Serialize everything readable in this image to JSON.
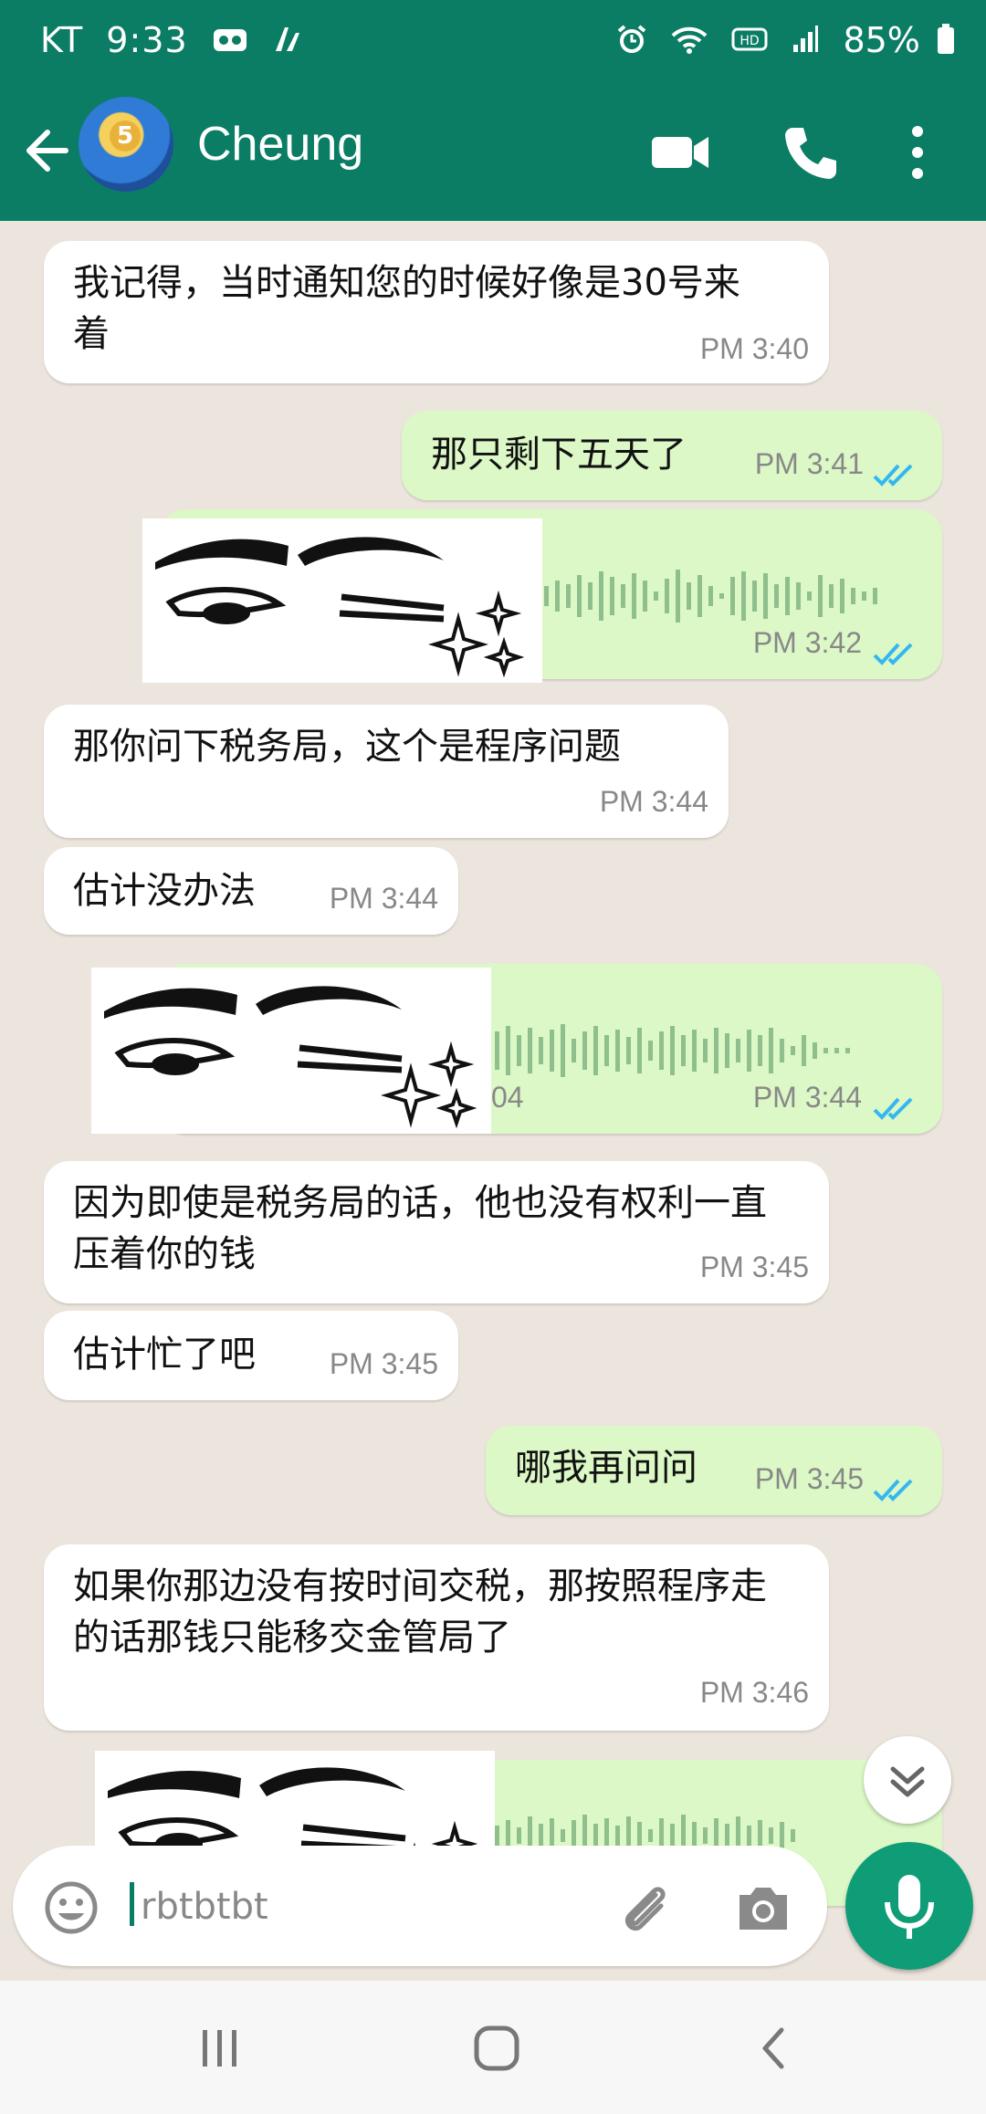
{
  "status_bar": {
    "carrier": "KT",
    "time": "9:33",
    "battery": "85%",
    "icons": [
      "voicemail-icon",
      "notification-icon",
      "alarm-icon",
      "wifi-icon",
      "hd-icon",
      "signal-icon",
      "battery-icon"
    ]
  },
  "header": {
    "contact_name": "Cheung",
    "avatar_badge": "5"
  },
  "messages": [
    {
      "dir": "in",
      "text": "我记得，当时通知您的时候好像是30号来着",
      "time": "PM 3:40"
    },
    {
      "dir": "out",
      "text": "那只剩下五天了",
      "time": "PM 3:41",
      "read": true
    },
    {
      "dir": "out",
      "type": "voice",
      "time": "PM 3:42",
      "read": true
    },
    {
      "dir": "in",
      "text": "那你问下税务局，这个是程序问题",
      "time": "PM 3:44"
    },
    {
      "dir": "in",
      "text": "估计没办法",
      "time": "PM 3:44"
    },
    {
      "dir": "out",
      "type": "voice",
      "duration": "04",
      "time": "PM 3:44",
      "read": true
    },
    {
      "dir": "in",
      "text": "因为即使是税务局的话，他也没有权利一直压着你的钱",
      "time": "PM 3:45"
    },
    {
      "dir": "in",
      "text": "估计忙了吧",
      "time": "PM 3:45"
    },
    {
      "dir": "out",
      "text": "哪我再问问",
      "time": "PM 3:45",
      "read": true
    },
    {
      "dir": "in",
      "text": "如果你那边没有按时间交税，那按照程序走的话那钱只能移交金管局了",
      "time": "PM 3:46"
    },
    {
      "dir": "out",
      "type": "voice",
      "time": "",
      "read": false
    }
  ],
  "input": {
    "value": "rbtbtbt",
    "icons": [
      "emoji-icon",
      "attach-icon",
      "camera-icon",
      "mic-icon"
    ]
  },
  "colors": {
    "primary": "#0b7d64",
    "incoming": "#ffffff",
    "outgoing": "#dcf8c6",
    "read_tick": "#34b7f1",
    "background": "#ece5dd"
  }
}
